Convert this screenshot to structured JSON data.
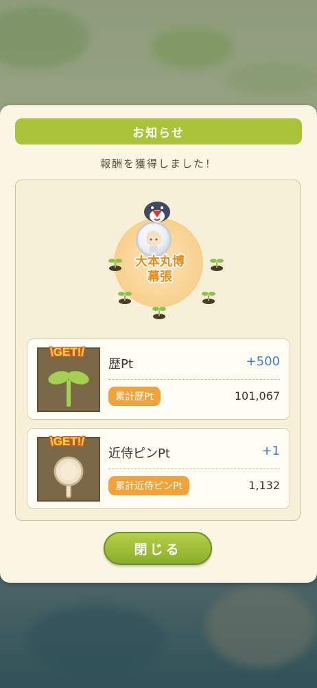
{
  "dialog": {
    "title": "お知らせ",
    "subtitle": "報酬を獲得しました！",
    "area_name_line1": "大本丸博",
    "area_name_line2": "幕張",
    "close_label": "閉じる"
  },
  "rewards": [
    {
      "icon": "sprout-icon",
      "badge": "\\GET!/",
      "label": "歴Pt",
      "gain": "+500",
      "total_label": "累計歴Pt",
      "total_value": "101,067"
    },
    {
      "icon": "magnifier-pin-icon",
      "badge": "\\GET!/",
      "label": "近侍ピンPt",
      "gain": "+1",
      "total_label": "累計近侍ピンPt",
      "total_value": "1,132"
    }
  ],
  "colors": {
    "title_bar": "#a9c43a",
    "pill": "#f0a33a",
    "gain": "#3f7ad0",
    "area_label": "#e98a18",
    "dialog_bg": "#fbf6e3"
  }
}
